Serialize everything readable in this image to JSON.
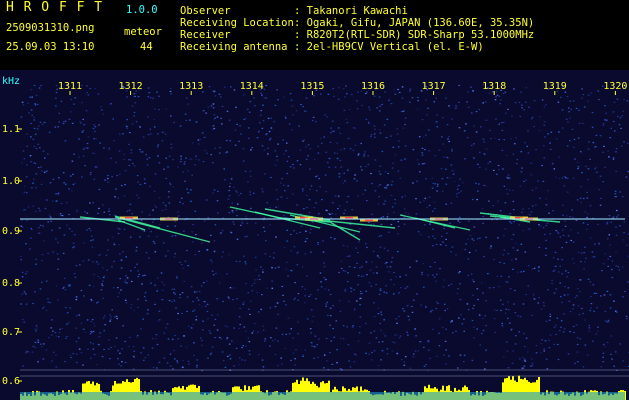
{
  "header": {
    "app_name": "H R O F F T",
    "app_version": "1.0.0",
    "filename": "2509031310.png",
    "mode_label": "meteor",
    "datetime": "25.09.03 13:10",
    "meteor_count": "44",
    "info_labels": {
      "observer": "Observer",
      "location": "Receiving Location",
      "receiver": "Receiver",
      "antenna": "Receiving antenna"
    },
    "info_values": {
      "observer": ": Takanori Kawachi",
      "location": ": Ogaki, Gifu, JAPAN (136.60E, 35.35N)",
      "receiver": ": R820T2(RTL-SDR) SDR-Sharp 53.1000MHz",
      "antenna": ": 2el-HB9CV Vertical (el. E-W)"
    }
  },
  "spectrogram": {
    "freq_unit": "kHz",
    "time_ticks": [
      "1311",
      "1312",
      "1313",
      "1314",
      "1315",
      "1316",
      "1317",
      "1318",
      "1319",
      "1320"
    ],
    "freq_ticks": [
      "1.1",
      "1.0",
      "0.9",
      "0.8",
      "0.7",
      "0.6"
    ],
    "colors": {
      "background": "#0a0a2e",
      "noise": "#2a3aa0",
      "carrier": "#9fe3ff",
      "meteor_hot": "#ff4040",
      "meteor_mid": "#ffe040",
      "meteor_cool": "#40ffa0",
      "histogram": "#ffff00",
      "tick_text": "#ffff33",
      "axis_text": "#33ffff"
    }
  }
}
